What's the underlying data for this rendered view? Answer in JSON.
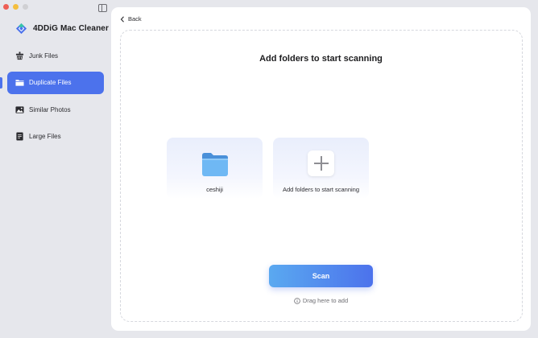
{
  "app": {
    "name": "4DDiG Mac Cleaner"
  },
  "sidebar": {
    "items": [
      {
        "label": "Junk Files",
        "icon": "broom-icon",
        "active": false
      },
      {
        "label": "Duplicate Files",
        "icon": "folder-icon",
        "active": true
      },
      {
        "label": "Similar Photos",
        "icon": "photo-icon",
        "active": false
      },
      {
        "label": "Large Files",
        "icon": "file-icon",
        "active": false
      }
    ]
  },
  "main": {
    "back_label": "Back",
    "title": "Add folders to start scanning",
    "cards": [
      {
        "label": "ceshiji",
        "icon": "folder-icon"
      },
      {
        "label": "Add folders to start scanning",
        "icon": "plus-icon"
      }
    ],
    "scan_label": "Scan",
    "drag_hint": "Drag here to add"
  },
  "colors": {
    "accent": "#4c72ec",
    "scan_gradient_start": "#5aa9f0",
    "scan_gradient_end": "#4c72ec",
    "folder": "#5aa9f0",
    "window_bg": "#e6e7ec"
  }
}
